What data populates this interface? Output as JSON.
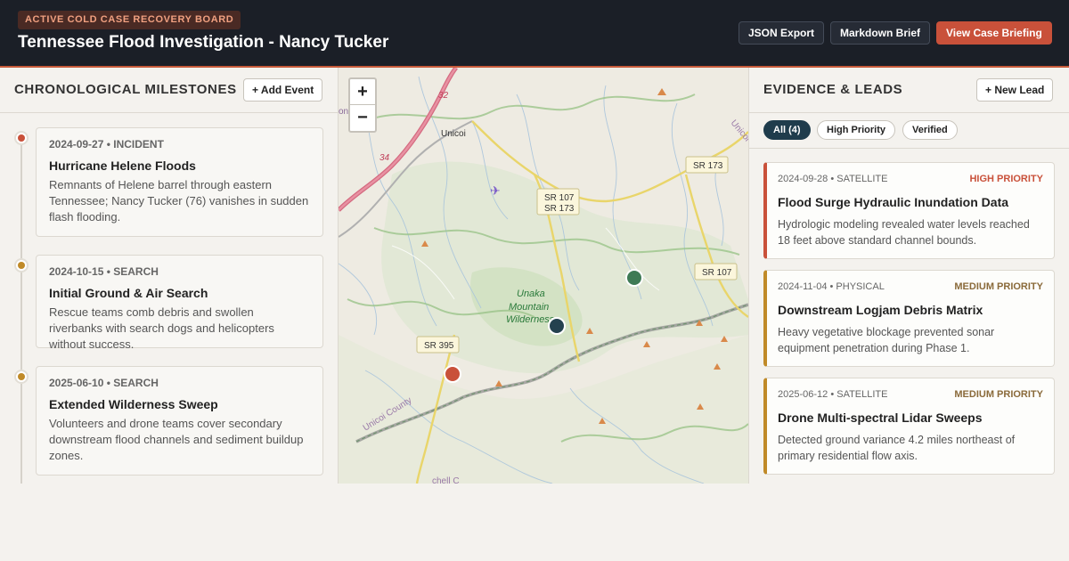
{
  "header": {
    "badge": "ACTIVE COLD CASE RECOVERY BOARD",
    "title": "Tennessee Flood Investigation - Nancy Tucker",
    "buttons": {
      "json_export": "JSON Export",
      "markdown_brief": "Markdown Brief",
      "view_briefing": "View Case Briefing"
    }
  },
  "timeline": {
    "title": "CHRONOLOGICAL MILESTONES",
    "add_label": "+ Add Event",
    "events": [
      {
        "meta": "2024-09-27 • INCIDENT",
        "title": "Hurricane Helene Floods",
        "description": "Remnants of Helene barrel through eastern Tennessee; Nancy Tucker (76) vanishes in sudden flash flooding.",
        "dot_color": "#c9513a"
      },
      {
        "meta": "2024-10-15 • SEARCH",
        "title": "Initial Ground & Air Search",
        "description": "Rescue teams comb debris and swollen riverbanks with search dogs and helicopters without success.",
        "dot_color": "#c08a28"
      },
      {
        "meta": "2025-06-10 • SEARCH",
        "title": "Extended Wilderness Sweep",
        "description": "Volunteers and drone teams cover secondary downstream flood channels and sediment buildup zones.",
        "dot_color": "#c08a28"
      }
    ]
  },
  "map": {
    "zoom_in": "+",
    "zoom_out": "−",
    "labels": {
      "town": "Unicoi",
      "wilderness_1": "Unaka",
      "wilderness_2": "Mountain",
      "wilderness_3": "Wilderness",
      "county": "Unicoi County",
      "county_ne": "Unicoi",
      "route_32": "32",
      "route_34": "34",
      "left_edge": "on",
      "bottom_edge": "chell C",
      "shields": {
        "sr107_173_a": "SR 107",
        "sr107_173_b": "SR 173",
        "sr173": "SR 173",
        "sr107": "SR 107",
        "sr395": "SR 395"
      }
    },
    "markers": {
      "red": "#c9513a",
      "green": "#3e7a55",
      "navy": "#24414f"
    }
  },
  "evidence": {
    "title": "EVIDENCE & LEADS",
    "add_label": "+ New Lead",
    "filters": [
      "All (4)",
      "High Priority",
      "Verified"
    ],
    "leads": [
      {
        "meta": "2024-09-28 • SATELLITE",
        "priority": "HIGH PRIORITY",
        "title": "Flood Surge Hydraulic Inundation Data",
        "description": "Hydrologic modeling revealed water levels reached 18 feet above standard channel bounds.",
        "priority_color": "#c9513a"
      },
      {
        "meta": "2024-11-04 • PHYSICAL",
        "priority": "MEDIUM PRIORITY",
        "title": "Downstream Logjam Debris Matrix",
        "description": "Heavy vegetative blockage prevented sonar equipment penetration during Phase 1.",
        "priority_color": "#8a6a3a"
      },
      {
        "meta": "2025-06-12 • SATELLITE",
        "priority": "MEDIUM PRIORITY",
        "title": "Drone Multi-spectral Lidar Sweeps",
        "description": "Detected ground variance 4.2 miles northeast of primary residential flow axis.",
        "priority_color": "#8a6a3a"
      }
    ]
  }
}
